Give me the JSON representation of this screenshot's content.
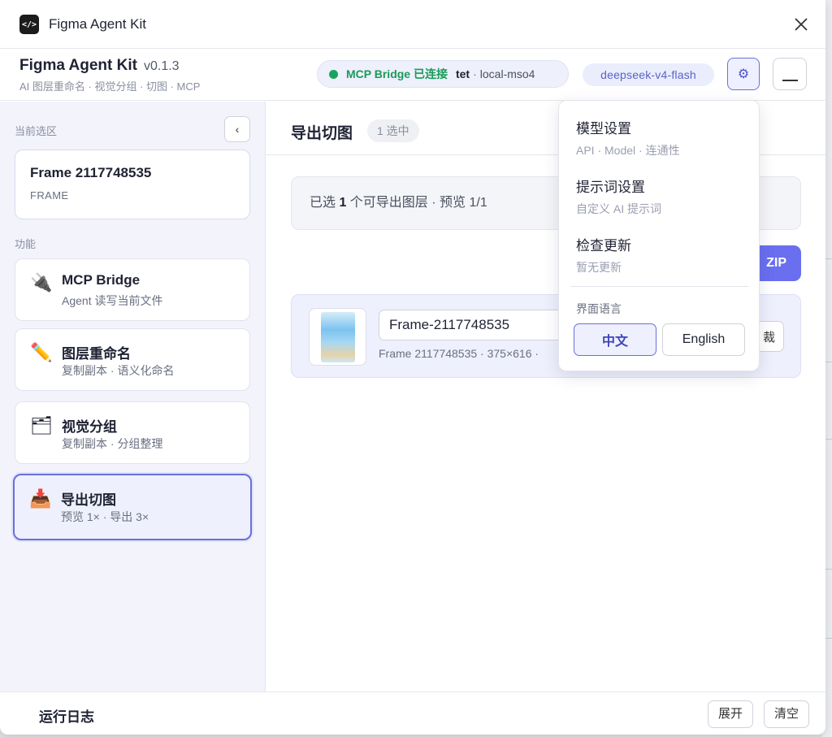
{
  "window": {
    "title": "Figma Agent Kit"
  },
  "header": {
    "brand": "Figma Agent Kit",
    "version": "v0.1.3",
    "tagline": "AI 图层重命名 · 视觉分组 · 切图 · MCP",
    "bridge_label": "MCP Bridge 已连接",
    "bridge_user": "tet",
    "bridge_sep": "·",
    "bridge_host": "local-mso4",
    "model": "deepseek-v4-flash",
    "settings_icon": "⚙"
  },
  "sidebar": {
    "selection_label": "当前选区",
    "collapse_icon": "‹",
    "selection": {
      "name": "Frame 2117748535",
      "type": "FRAME"
    },
    "features_label": "功能",
    "features": [
      {
        "icon": "🔌",
        "title": "MCP Bridge",
        "subtitle": "Agent 读写当前文件"
      },
      {
        "icon": "✏️",
        "title": "图层重命名",
        "subtitle": "复制副本 · 语义化命名"
      },
      {
        "icon": "🗂",
        "title": "视觉分组",
        "subtitle": "复制副本 · 分组整理"
      },
      {
        "icon": "📥",
        "title": "导出切图",
        "subtitle": "预览 1× · 导出 3×"
      }
    ]
  },
  "main": {
    "title": "导出切图",
    "count_badge": "1 选中",
    "info_prefix": "已选 ",
    "info_count": "1",
    "info_suffix": " 个可导出图层 · 预览 1/1",
    "zip_label": "ZIP",
    "export_item": {
      "name_value": "Frame-2117748535",
      "meta": "Frame 2117748535 · 375×616 ·",
      "cut_label": "裁"
    }
  },
  "footer": {
    "log_title": "运行日志",
    "expand": "展开",
    "clear": "清空"
  },
  "menu": {
    "items": [
      {
        "title": "模型设置",
        "subtitle": "API · Model · 连通性"
      },
      {
        "title": "提示词设置",
        "subtitle": "自定义 AI 提示词"
      },
      {
        "title": "检查更新",
        "subtitle": "暂无更新"
      }
    ],
    "lang_label": "界面语言",
    "lang_zh": "中文",
    "lang_en": "English",
    "selected_lang": "中文"
  },
  "colors": {
    "accent": "#6a70d8",
    "connected": "#1aa45f",
    "zip": "#6a6ff0"
  }
}
